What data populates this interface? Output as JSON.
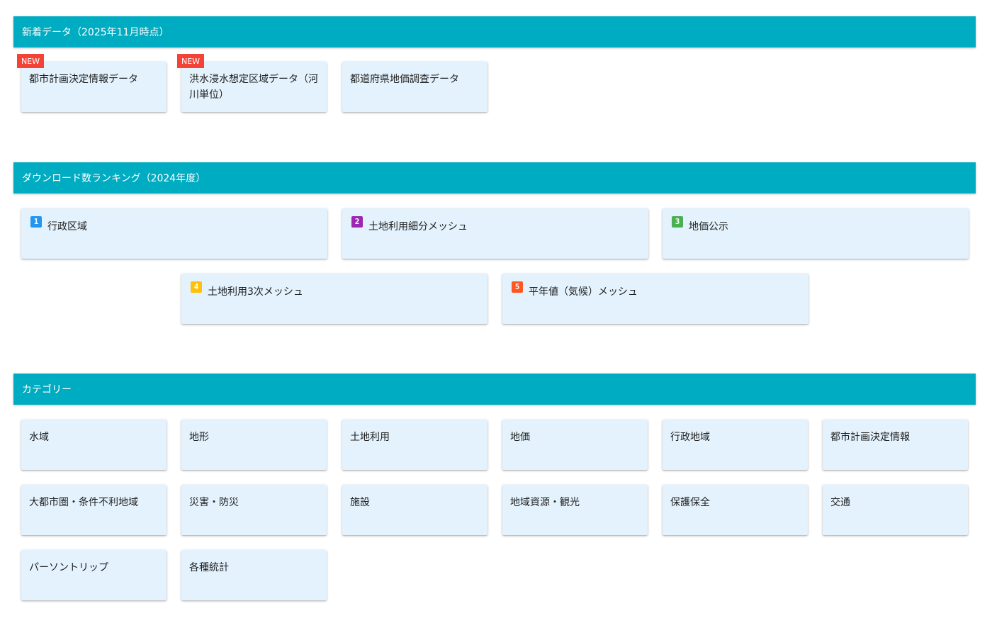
{
  "sections": {
    "new_data": {
      "title": "新着データ（2025年11月時点）"
    },
    "ranking": {
      "title": "ダウンロード数ランキング（2024年度）"
    },
    "categories": {
      "title": "カテゴリー"
    }
  },
  "new_data_items": [
    {
      "label": "都市計画決定情報データ",
      "badge": "NEW"
    },
    {
      "label": "洪水浸水想定区域データ（河川単位）",
      "badge": "NEW"
    },
    {
      "label": "都道府県地価調査データ"
    }
  ],
  "ranking_items": [
    {
      "rank": "1",
      "label": "行政区域",
      "color": "#2196f3"
    },
    {
      "rank": "2",
      "label": "土地利用細分メッシュ",
      "color": "#9c27b0"
    },
    {
      "rank": "3",
      "label": "地価公示",
      "color": "#4caf50"
    },
    {
      "rank": "4",
      "label": "土地利用3次メッシュ",
      "color": "#ffc107"
    },
    {
      "rank": "5",
      "label": "平年値（気候）メッシュ",
      "color": "#ff5722"
    }
  ],
  "category_items": [
    "水域",
    "地形",
    "土地利用",
    "地価",
    "行政地域",
    "都市計画決定情報",
    "大都市圏・条件不利地域",
    "災害・防災",
    "施設",
    "地域資源・観光",
    "保護保全",
    "交通",
    "パーソントリップ",
    "各種統計"
  ],
  "colors": {
    "header": "#00acc1",
    "card": "#e3f2fd",
    "new_badge": "#f44336"
  }
}
